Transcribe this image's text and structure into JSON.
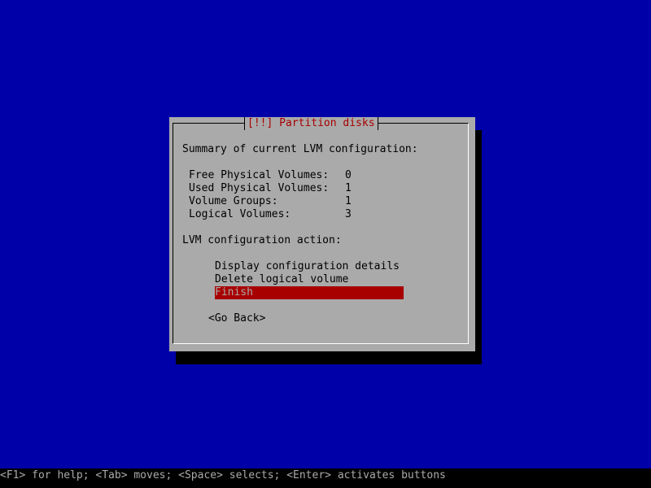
{
  "dialog": {
    "title": "[!!] Partition disks",
    "summary_heading": "Summary of current LVM configuration:",
    "summary": [
      {
        "label": "Free Physical Volumes:",
        "value": "0"
      },
      {
        "label": "Used Physical Volumes:",
        "value": "1"
      },
      {
        "label": "Volume Groups:",
        "value": "1"
      },
      {
        "label": "Logical Volumes:",
        "value": "3"
      }
    ],
    "action_heading": "LVM configuration action:",
    "menu": [
      {
        "label": "Display configuration details",
        "selected": false
      },
      {
        "label": "Delete logical volume",
        "selected": false
      },
      {
        "label": "Finish",
        "selected": true
      }
    ],
    "go_back_label": "<Go Back>"
  },
  "status_bar": {
    "text": "<F1> for help; <Tab> moves; <Space> selects; <Enter> activates buttons"
  },
  "colors": {
    "background": "#0000a8",
    "dialog": "#aaaaaa",
    "title_text": "#a80000",
    "selection": "#a80000",
    "status_bar": "#000000"
  }
}
